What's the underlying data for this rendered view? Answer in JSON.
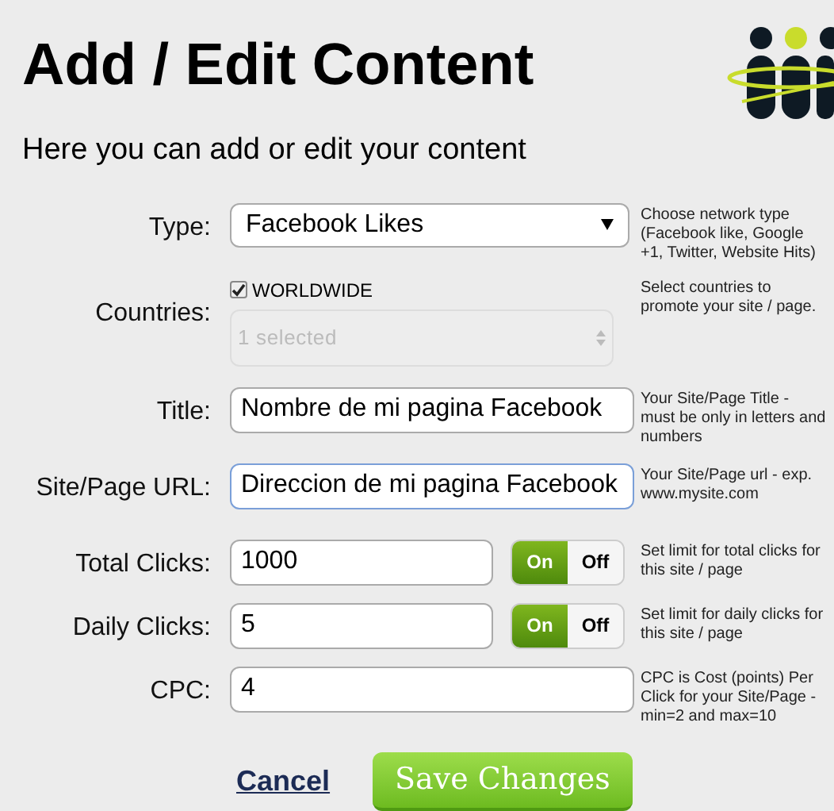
{
  "title": "Add / Edit Content",
  "subtitle": "Here you can add or edit your content",
  "fields": [
    {
      "kind": "select",
      "label": "Type:",
      "value": "Facebook Likes",
      "help": "Choose network type (Facebook like, Google +1, Twitter, Website Hits)"
    },
    {
      "kind": "countries",
      "label": "Countries:",
      "checkbox_label": "WORLDWIDE",
      "checked": true,
      "value": "1 selected",
      "disabled": true,
      "help": "Select countries to promote your site / page."
    },
    {
      "kind": "text",
      "label": "Title:",
      "value": "Nombre de mi pagina Facebook",
      "focused": false,
      "help": "Your Site/Page Title - must be only in letters and numbers"
    },
    {
      "kind": "text",
      "label": "Site/Page URL:",
      "value": "Direccion de mi pagina Facebook",
      "focused": true,
      "help": "Your Site/Page url - exp. www.mysite.com"
    },
    {
      "kind": "toggle",
      "label": "Total Clicks:",
      "value": "1000",
      "on": true,
      "on_label": "On",
      "off_label": "Off",
      "help": "Set limit for total clicks for this site / page"
    },
    {
      "kind": "toggle",
      "label": "Daily Clicks:",
      "value": "5",
      "on": true,
      "on_label": "On",
      "off_label": "Off",
      "help": "Set limit for daily clicks for this site / page"
    },
    {
      "kind": "text",
      "label": "CPC:",
      "value": "4",
      "focused": false,
      "help": "CPC is Cost (points) Per Click for your Site/Page - min=2 and max=10"
    }
  ],
  "cancel": "Cancel",
  "save": "Save Changes"
}
